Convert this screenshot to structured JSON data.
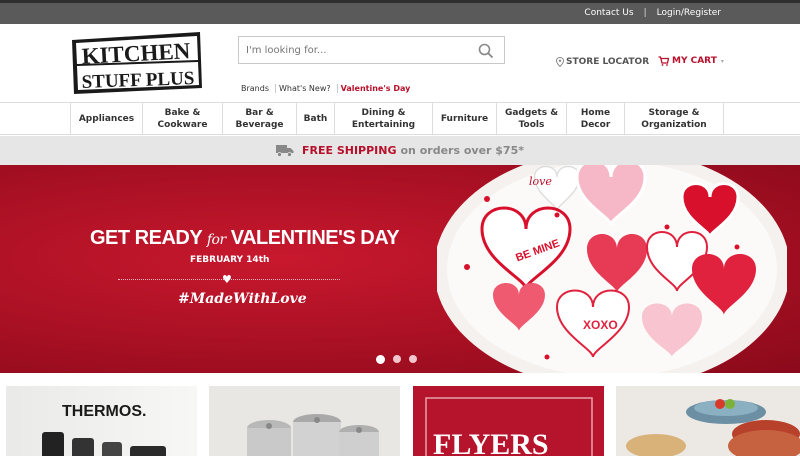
{
  "topbar": {
    "contact": "Contact Us",
    "separator": "|",
    "login": "Login/Register"
  },
  "logo": {
    "line1": "KITCHEN",
    "line2": "STUFF PLUS"
  },
  "search": {
    "placeholder": "I'm looking for..."
  },
  "sublinks": [
    "Brands",
    "What's New?",
    "Valentine's Day"
  ],
  "store_locator": "STORE LOCATOR",
  "cart": "MY CART",
  "nav": [
    {
      "label": "Appliances"
    },
    {
      "label": "Bake & Cookware"
    },
    {
      "label": "Bar & Beverage"
    },
    {
      "label": "Bath"
    },
    {
      "label": "Dining & Entertaining"
    },
    {
      "label": "Furniture"
    },
    {
      "label": "Gadgets & Tools"
    },
    {
      "label": "Home Decor"
    },
    {
      "label": "Storage & Organization"
    }
  ],
  "shipping": {
    "strong": "FREE SHIPPING",
    "rest": "on orders over $75*"
  },
  "hero": {
    "headline_a": "GET READY ",
    "headline_for": "for",
    "headline_b": " VALENTINE'S DAY",
    "date": "FEBRUARY 14th",
    "tag": "#MadeWithLove",
    "cookie_texts": [
      "love",
      "BE MINE",
      "XOXO"
    ]
  },
  "tiles": {
    "thermos": "THERMOS.",
    "flyers": "FLYERS"
  },
  "colors": {
    "brand_red": "#b8102a",
    "hero_red": "#a50f22",
    "topbar": "#5a5a5a"
  }
}
